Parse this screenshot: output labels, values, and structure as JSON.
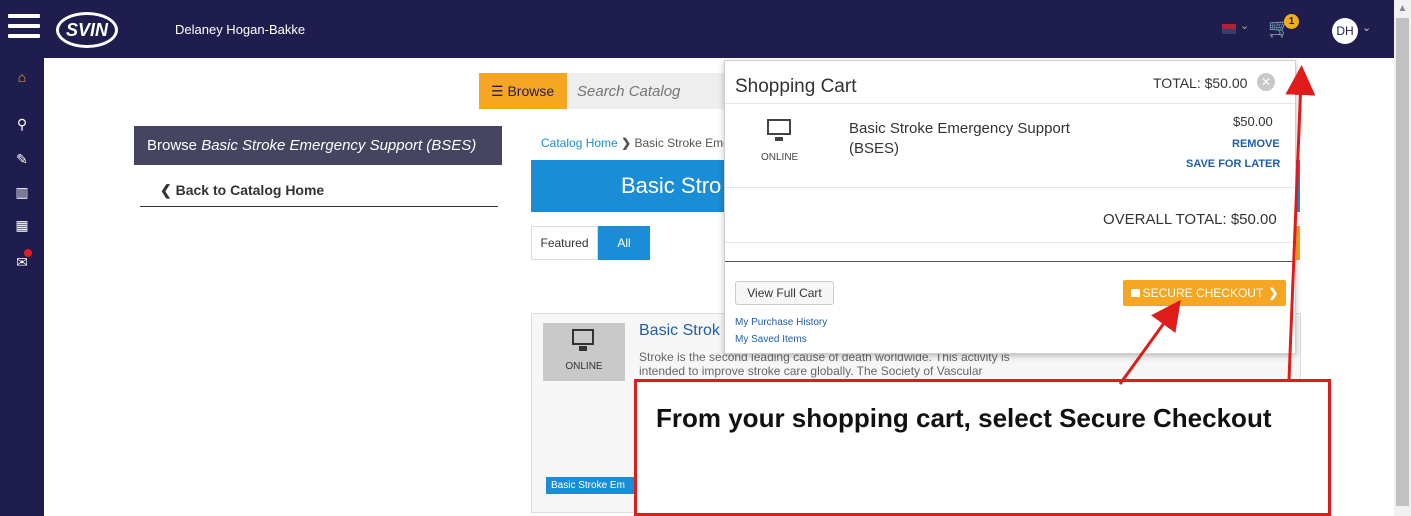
{
  "header": {
    "logo_text": "SVIN",
    "username": "Delaney Hogan-Bakke",
    "cart_count": "1",
    "avatar_initials": "DH"
  },
  "sidebar": {
    "icons": [
      "home-icon",
      "search-icon",
      "edit-icon",
      "catalog-icon",
      "calendar-icon",
      "mail-icon"
    ]
  },
  "search": {
    "browse_label": "Browse",
    "placeholder": "Search Catalog"
  },
  "left_panel": {
    "browse_prefix": "Browse ",
    "browse_course": "Basic Stroke Emergency Support (BSES)",
    "back_link": "Back to Catalog Home"
  },
  "main": {
    "breadcrumb_home": "Catalog Home",
    "breadcrumb_sep": "❯",
    "breadcrumb_current": "Basic Stroke Eme",
    "banner_title": "Basic Stro",
    "tab_featured": "Featured",
    "tab_all": "All",
    "card": {
      "format": "ONLINE",
      "title": "Basic Strok",
      "description": "Stroke is the second leading cause of death worldwide. This activity is intended to improve stroke care globally. The Society of Vascular",
      "tag": "Basic Stroke Em"
    }
  },
  "cart": {
    "title": "Shopping Cart",
    "total": "TOTAL: $50.00",
    "item_format": "ONLINE",
    "item_name": "Basic Stroke Emergency Support (BSES)",
    "item_price": "$50.00",
    "remove": "REMOVE",
    "save_for_later": "SAVE FOR LATER",
    "overall_total": "OVERALL TOTAL: $50.00",
    "view_full_cart": "View Full Cart",
    "purchase_history": "My Purchase History",
    "saved_items": "My Saved Items",
    "secure_checkout": "SECURE CHECKOUT"
  },
  "callout": {
    "text": "From your shopping cart, select Secure Checkout"
  },
  "colors": {
    "nav": "#1f1d4d",
    "accent": "#f5a623",
    "blue": "#1a8dd6",
    "callout_border": "#e01b1b"
  }
}
